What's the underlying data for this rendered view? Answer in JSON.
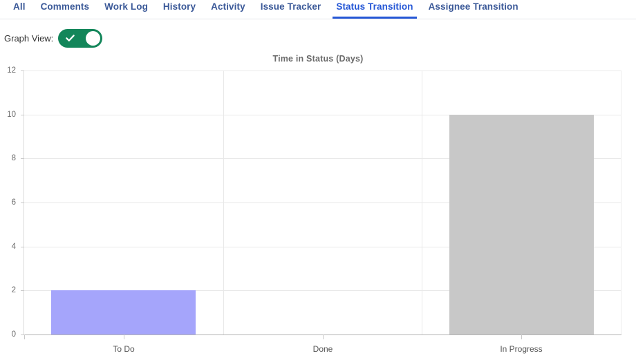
{
  "tabs": [
    {
      "label": "All",
      "active": false
    },
    {
      "label": "Comments",
      "active": false
    },
    {
      "label": "Work Log",
      "active": false
    },
    {
      "label": "History",
      "active": false
    },
    {
      "label": "Activity",
      "active": false
    },
    {
      "label": "Issue Tracker",
      "active": false
    },
    {
      "label": "Status Transition",
      "active": true
    },
    {
      "label": "Assignee Transition",
      "active": false
    }
  ],
  "controls": {
    "graph_view_label": "Graph View:",
    "graph_view_on": true,
    "toggle_on_color": "#13865a",
    "toggle_knob_color": "#ffffff"
  },
  "colors": {
    "tab_text": "#3b5998",
    "tab_active": "#2557d6",
    "grid": "#e8e8e8",
    "axis": "#b4b4b4",
    "tick_text": "#6b6b6b"
  },
  "chart_data": {
    "type": "bar",
    "title": "Time in Status (Days)",
    "xlabel": "",
    "ylabel": "",
    "categories": [
      "To Do",
      "Done",
      "In Progress"
    ],
    "values": [
      2,
      0,
      10
    ],
    "bar_colors": [
      "#a5a5fb",
      "#c8c8c8",
      "#c8c8c8"
    ],
    "ylim": [
      0,
      12
    ],
    "yticks": [
      0,
      2,
      4,
      6,
      8,
      10,
      12
    ],
    "ytick_labels": [
      "0",
      "2",
      "4",
      "6",
      "8",
      "10",
      "12"
    ],
    "grid": true,
    "legend": false
  }
}
